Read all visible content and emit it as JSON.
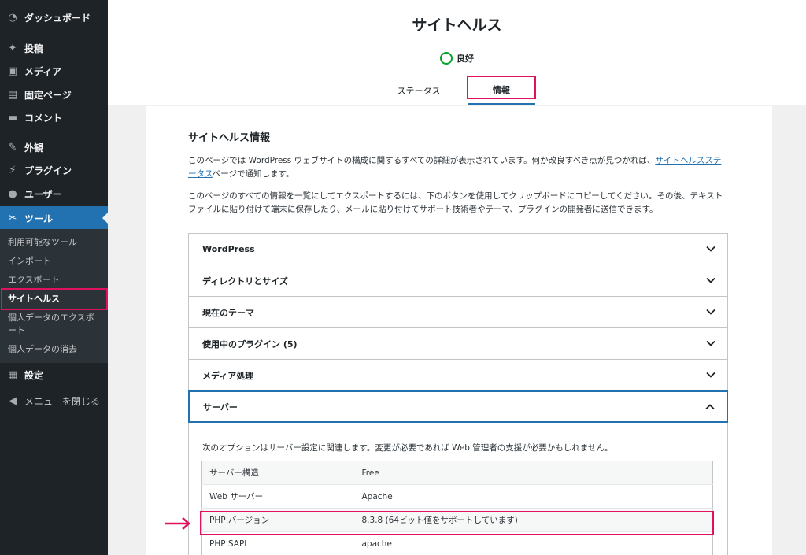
{
  "sidebar": {
    "items": [
      {
        "label": "ダッシュボード",
        "icon": "dashboard-icon"
      },
      {
        "label": "投稿",
        "icon": "pin-icon"
      },
      {
        "label": "メディア",
        "icon": "media-icon"
      },
      {
        "label": "固定ページ",
        "icon": "page-icon"
      },
      {
        "label": "コメント",
        "icon": "comment-icon"
      },
      {
        "label": "外観",
        "icon": "brush-icon"
      },
      {
        "label": "プラグイン",
        "icon": "plugin-icon"
      },
      {
        "label": "ユーザー",
        "icon": "user-icon"
      },
      {
        "label": "ツール",
        "icon": "wrench-icon"
      },
      {
        "label": "設定",
        "icon": "settings-icon"
      },
      {
        "label": "メニューを閉じる",
        "icon": "collapse-icon"
      }
    ],
    "submenu": [
      {
        "label": "利用可能なツール"
      },
      {
        "label": "インポート"
      },
      {
        "label": "エクスポート"
      },
      {
        "label": "サイトヘルス"
      },
      {
        "label": "個人データのエクスポート"
      },
      {
        "label": "個人データの消去"
      }
    ]
  },
  "header": {
    "title": "サイトヘルス",
    "status": "良好",
    "tabs": [
      {
        "label": "ステータス"
      },
      {
        "label": "情報"
      }
    ]
  },
  "main": {
    "section_title": "サイトヘルス情報",
    "para1_a": "このページでは WordPress ウェブサイトの構成に関するすべての詳細が表示されています。何か改良すべき点が見つかれば、",
    "para1_link": "サイトヘルスステータス",
    "para1_b": "ページで通知します。",
    "para2": "このページのすべての情報を一覧にしてエクスポートするには、下のボタンを使用してクリップボードにコピーしてください。その後、テキストファイルに貼り付けて端末に保存したり、メールに貼り付けてサポート技術者やテーマ、プラグインの開発者に送信できます。",
    "accordion": [
      {
        "label": "WordPress"
      },
      {
        "label": "ディレクトリとサイズ"
      },
      {
        "label": "現在のテーマ"
      },
      {
        "label": "使用中のプラグイン (5)"
      },
      {
        "label": "メディア処理"
      },
      {
        "label": "サーバー"
      }
    ],
    "server": {
      "description": "次のオプションはサーバー設定に関連します。変更が必要であれば Web 管理者の支援が必要かもしれません。",
      "rows": [
        {
          "key": "サーバー構造",
          "value": "Free"
        },
        {
          "key": "Web サーバー",
          "value": "Apache"
        },
        {
          "key": "PHP バージョン",
          "value": "8.3.8 (64ビット値をサポートしています)"
        },
        {
          "key": "PHP SAPI",
          "value": "apache"
        }
      ]
    }
  },
  "colors": {
    "sidebar_bg": "#1d2327",
    "accent": "#2271b1",
    "highlight": "#e0115f",
    "status_good": "#00a32a"
  }
}
